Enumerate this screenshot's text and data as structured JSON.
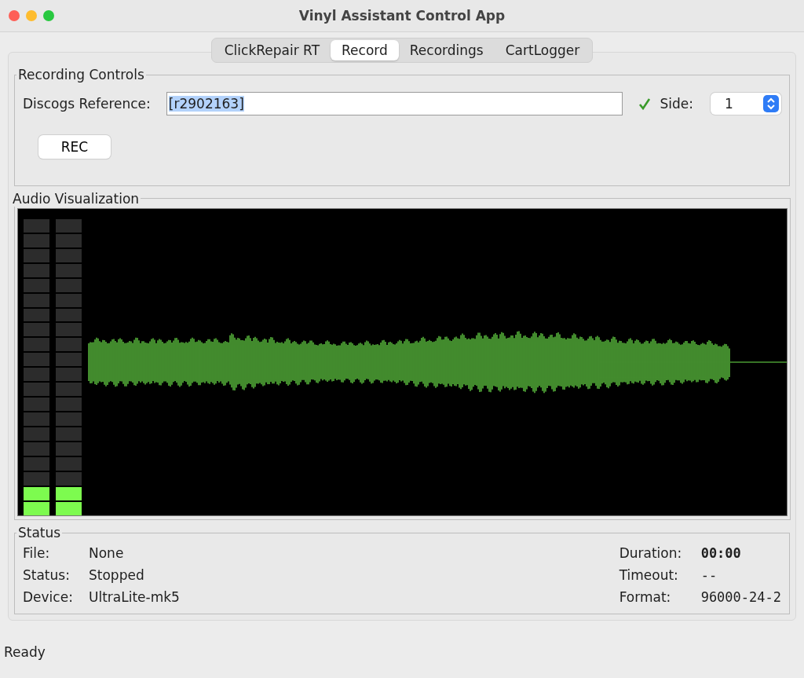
{
  "window": {
    "title": "Vinyl Assistant Control App"
  },
  "tabs": [
    {
      "label": "ClickRepair RT",
      "selected": false
    },
    {
      "label": "Record",
      "selected": true
    },
    {
      "label": "Recordings",
      "selected": false
    },
    {
      "label": "CartLogger",
      "selected": false
    }
  ],
  "recording_controls": {
    "title": "Recording Controls",
    "reference_label": "Discogs Reference:",
    "reference_value": "[r2902163]",
    "reference_text_selected": true,
    "reference_valid": true,
    "side_label": "Side:",
    "side_value": "1",
    "rec_button": "REC"
  },
  "audio_visualization": {
    "title": "Audio Visualization",
    "meters": [
      {
        "level": 0.1
      },
      {
        "level": 0.1
      }
    ]
  },
  "status": {
    "title": "Status",
    "left": [
      {
        "label": "File:",
        "value": "None",
        "bold": false
      },
      {
        "label": "Status:",
        "value": "Stopped",
        "bold": false
      },
      {
        "label": "Device:",
        "value": "UltraLite-mk5",
        "bold": false
      }
    ],
    "right": [
      {
        "label": "Duration:",
        "value": "00:00",
        "bold": true
      },
      {
        "label": "Timeout:",
        "value": "--",
        "bold": false
      },
      {
        "label": "Format:",
        "value": "96000-24-2",
        "bold": false
      }
    ]
  },
  "status_bar": "Ready"
}
